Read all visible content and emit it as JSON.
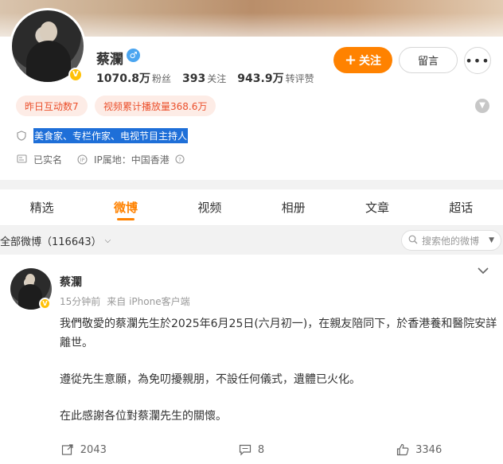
{
  "profile": {
    "name": "蔡瀾",
    "gender_symbol": "♂",
    "verified_badge": "V",
    "stats": [
      {
        "num": "1070.8万",
        "label": "粉丝"
      },
      {
        "num": "393",
        "label": "关注"
      },
      {
        "num": "943.9万",
        "label": "转评赞"
      }
    ],
    "follow_label": "关注",
    "follow_plus": "+",
    "message_label": "留言",
    "more_label": "•••",
    "tags": [
      "昨日互动数7",
      "视频累计播放量368.6万"
    ],
    "description": "美食家、专栏作家、电视节目主持人",
    "real_name_status": "已实名",
    "ip_location": "IP属地：中国香港"
  },
  "tabs": [
    {
      "label": "精选",
      "active": false
    },
    {
      "label": "微博",
      "active": true
    },
    {
      "label": "视频",
      "active": false
    },
    {
      "label": "相册",
      "active": false
    },
    {
      "label": "文章",
      "active": false
    },
    {
      "label": "超话",
      "active": false
    }
  ],
  "filter": {
    "label": "全部微博（116643）",
    "search_placeholder": "搜索他的微博"
  },
  "post": {
    "author": "蔡瀾",
    "time": "15分钟前",
    "source": "来自 iPhone客户端",
    "paragraphs": [
      "我們敬愛的蔡瀾先生於2025年6月25日(六月初一)，在親友陪同下，於香港養和醫院安詳離世。",
      "遵從先生意願，為免叨擾親朋，不設任何儀式，遺體已火化。",
      "在此感謝各位對蔡瀾先生的關懷。"
    ],
    "reposts": "2043",
    "comments": "8",
    "likes": "3346"
  },
  "colors": {
    "accent": "#ff8200",
    "tag_text": "#eb4f2b",
    "tag_bg": "#fdece6",
    "selection": "#1e6fd8"
  }
}
